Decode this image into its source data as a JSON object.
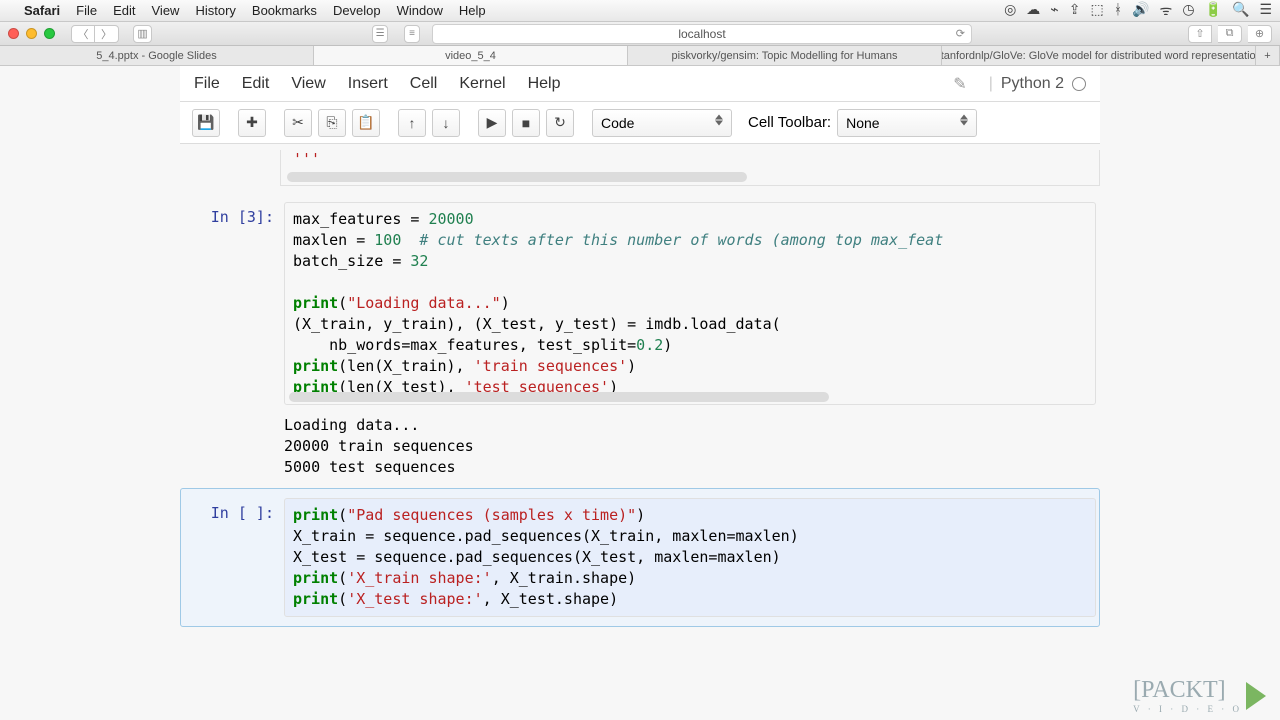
{
  "mac_menu": {
    "app": "Safari",
    "items": [
      "File",
      "Edit",
      "View",
      "History",
      "Bookmarks",
      "Develop",
      "Window",
      "Help"
    ]
  },
  "browser": {
    "url": "localhost",
    "tabs": [
      "5_4.pptx - Google Slides",
      "video_5_4",
      "piskvorky/gensim: Topic Modelling for Humans",
      "stanfordnlp/GloVe: GloVe model for distributed word representation"
    ]
  },
  "notebook": {
    "menus": [
      "File",
      "Edit",
      "View",
      "Insert",
      "Cell",
      "Kernel",
      "Help"
    ],
    "kernel": "Python 2",
    "cell_type": "Code",
    "cell_toolbar_label": "Cell Toolbar:",
    "cell_toolbar": "None"
  },
  "cells": {
    "top_remnant": "'''",
    "c1_prompt": "In [3]:",
    "c1_out_prompt": "",
    "c1_output": "Loading data...\n20000 train sequences\n5000 test sequences",
    "c2_prompt": "In [ ]:"
  },
  "code": {
    "c1": {
      "l1a": "max_features = ",
      "l1n": "20000",
      "l2a": "maxlen = ",
      "l2n": "100",
      "l2c": "  # cut texts after this number of words (among top max_feat",
      "l3a": "batch_size = ",
      "l3n": "32",
      "l5p": "print",
      "l5s": "\"Loading data...\"",
      "l6": "(X_train, y_train), (X_test, y_test) = imdb.load_data(",
      "l7": "    nb_words=max_features, test_split=",
      "l7n": "0.2",
      "l7e": ")",
      "l8p": "print",
      "l8m": "(len(X_train), ",
      "l8s": "'train sequences'",
      "l8e": ")",
      "l9p": "print",
      "l9m": "(len(X_test), ",
      "l9s": "'test sequences'",
      "l9e": ")"
    },
    "c2": {
      "l1p": "print",
      "l1s": "\"Pad sequences (samples x time)\"",
      "l2": "X_train = sequence.pad_sequences(X_train, maxlen=maxlen)",
      "l3": "X_test = sequence.pad_sequences(X_test, maxlen=maxlen)",
      "l4p": "print",
      "l4s": "'X_train shape:'",
      "l4m": ", X_train.shape)",
      "l5p": "print",
      "l5s": "'X_test shape:'",
      "l5m": ", X_test.shape)"
    }
  },
  "watermark": {
    "text": "[PACKT]",
    "sub": "V · I · D · E · O"
  }
}
